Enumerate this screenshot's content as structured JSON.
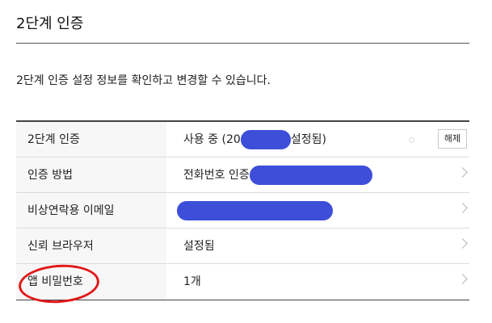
{
  "page": {
    "title": "2단계 인증",
    "description": "2단계 인증 설정 정보를 확인하고 변경할 수 있습니다."
  },
  "rows": [
    {
      "label": "2단계 인증",
      "value_prefix": "사용 중 (20",
      "value_suffix": "설정됨)",
      "button_label": "해제"
    },
    {
      "label": "인증 방법",
      "value_prefix": "전화번호 인증"
    },
    {
      "label": "비상연락용 이메일"
    },
    {
      "label": "신뢰 브라우저",
      "value_prefix": "설정됨"
    },
    {
      "label": "앱 비밀번호",
      "value_prefix": "1개"
    }
  ],
  "colors": {
    "redaction": "#3d4ed8",
    "annotation": "#e11919"
  },
  "icons": {
    "row_arrow": "chevron-right-icon"
  }
}
